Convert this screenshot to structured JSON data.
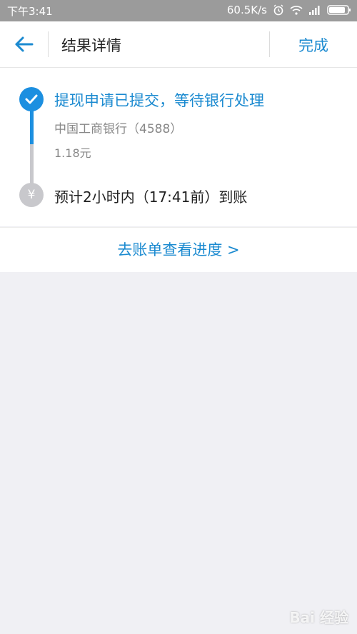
{
  "status_bar": {
    "time": "下午3:41",
    "speed": "60.5K/s",
    "icons": [
      "alarm-icon",
      "wifi-icon",
      "signal-icon",
      "battery-icon"
    ]
  },
  "header": {
    "back_icon": "back-arrow-icon",
    "title": "结果详情",
    "done_label": "完成"
  },
  "timeline": {
    "step1": {
      "icon": "check-icon",
      "title": "提现申请已提交，等待银行处理",
      "bank": "中国工商银行（4588）",
      "amount": "1.18元"
    },
    "step2": {
      "icon_glyph": "¥",
      "text": "预计2小时内（17:41前）到账"
    }
  },
  "link": {
    "label": "去账单查看进度 >"
  },
  "watermark": "Bai 经验",
  "colors": {
    "accent": "#1b8ad0",
    "timeline_active": "#1c8fe0",
    "timeline_inactive": "#c8c8cc",
    "statusbar": "#9b9b9b",
    "background": "#f0f0f4"
  }
}
